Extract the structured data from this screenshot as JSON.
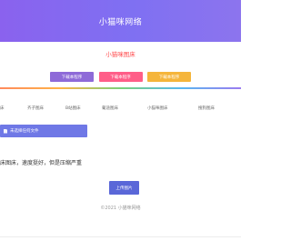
{
  "header": {
    "title": "小猫咪网络"
  },
  "main": {
    "subtitle": "小猫咪图床",
    "download_buttons": [
      {
        "label": "下载本程序",
        "color": "#8e6ad8"
      },
      {
        "label": "下载本程序",
        "color": "#ff5e88"
      },
      {
        "label": "下载本程序",
        "color": "#f5b53b"
      }
    ],
    "tabs": [
      "床",
      "齐子图床",
      "B站图床",
      "葡途图床",
      "小猫咪图床",
      "搜狗图床"
    ],
    "file_button_label": "未选择任何文件",
    "notice": "床图床，速度挺好，但是压缩严重",
    "upload_label": "上传图片"
  },
  "footer": {
    "text": "©2021 小猫咪网络"
  },
  "colors": {
    "header": "#8a62ee",
    "accent": "#5a67d8",
    "subtitle": "#ff4d4f"
  }
}
